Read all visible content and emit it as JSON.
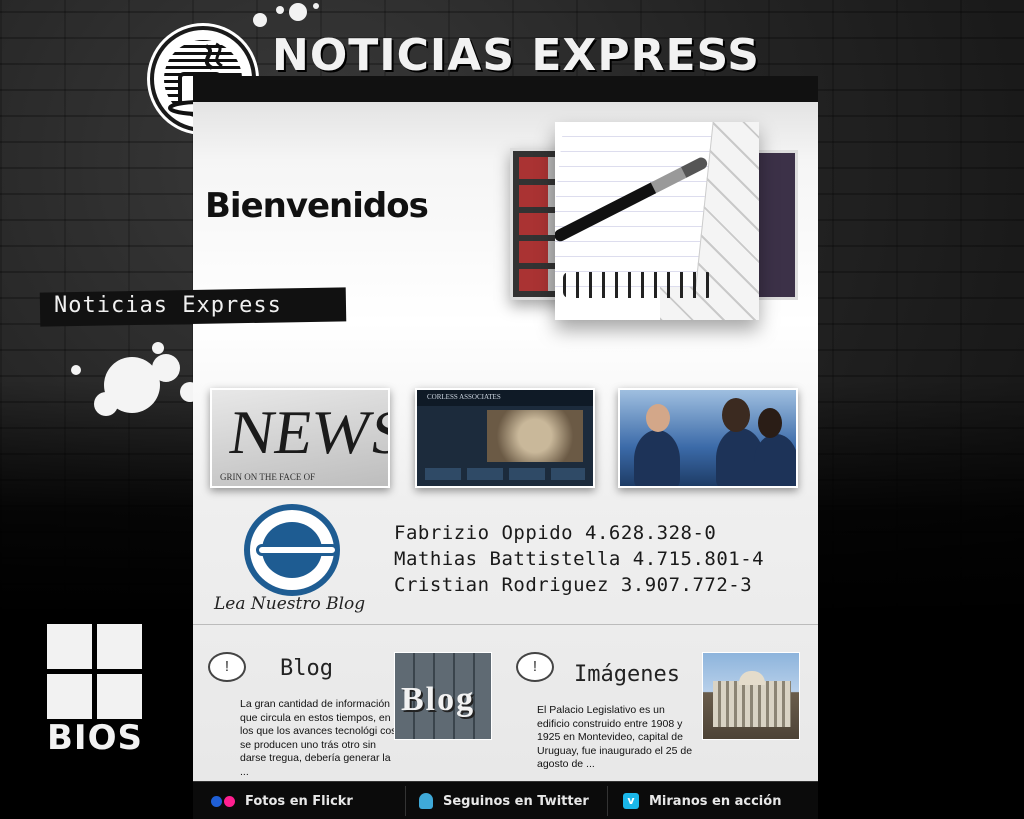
{
  "header": {
    "site_title": "NOTICIAS EXPRESS",
    "logo_icon": "coffee-cup-icon"
  },
  "hero": {
    "welcome": "Bienvenidos",
    "tagline": "Noticias Express"
  },
  "thumbnails": [
    {
      "name": "news",
      "big_text": "NEWS",
      "small_text": "GRIN ON THE FACE OF"
    },
    {
      "name": "corporate-site",
      "brand_text": "CORLESS ASSOCIATES"
    },
    {
      "name": "business-meeting"
    }
  ],
  "credits": {
    "lines": [
      "Fabrizio Oppido 4.628.328-0",
      "Mathias Battistella 4.715.801-4",
      "Cristian Rodriguez 3.907.772-3"
    ],
    "blog_link": "Lea Nuestro Blog"
  },
  "sections": {
    "blog": {
      "icon": "speech-bubble-icon",
      "bubble": "!",
      "title": "Blog",
      "image_text": "Blog",
      "text": "La gran cantidad de información que circula en estos tiempos, en los que los avances tecnológi cos se producen uno trás otro sin darse tregua, debería generar la ..."
    },
    "images": {
      "icon": "speech-bubble-icon",
      "bubble": "!",
      "title": "Imágenes",
      "text": "El Palacio Legislativo es un edificio construido entre 1908 y 1925 en Montevideo, capital de Uruguay, fue inaugurado el 25 de agosto de ..."
    }
  },
  "footer": {
    "flickr": "Fotos en Flickr",
    "twitter": "Seguinos en Twitter",
    "vimeo": "Miranos en acción",
    "colors": {
      "flickr_blue": "#1f5fd6",
      "flickr_pink": "#ff1f8f",
      "twitter": "#3fa9d8",
      "vimeo": "#1ab7ea"
    }
  },
  "branding": {
    "bios": "BIOS"
  }
}
